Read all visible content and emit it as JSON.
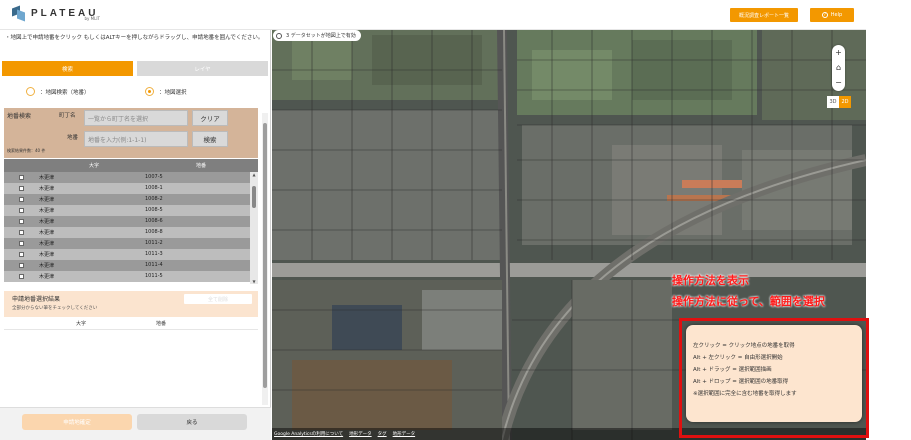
{
  "header": {
    "logo_text": "PLATEAU",
    "logo_sub": "by MLIT",
    "report_button": "概況調査レポート一覧",
    "help_button": "Help"
  },
  "left": {
    "instruction": "・地図上で申請地番をクリック もしくはALTキーを押しながらドラッグし、申請地番を囲んでください。",
    "tabs": [
      "検索",
      "レイヤ"
    ],
    "radio_options": [
      {
        "label": "：地図検索（地番）",
        "selected": false
      },
      {
        "label": "：地図選択",
        "selected": true
      }
    ],
    "search": {
      "title": "地番検索",
      "town_label": "町丁名",
      "town_placeholder": "一覧から町丁名を選択",
      "lot_label": "地番",
      "lot_placeholder": "地番を入力(例:1-1-1)",
      "clear_button": "クリア",
      "search_button": "検索",
      "result_count": "検索結果件数：40 件"
    },
    "table": {
      "headers": [
        "大字",
        "地番"
      ],
      "rows": [
        [
          "木更津",
          "1007-5"
        ],
        [
          "木更津",
          "1008-1"
        ],
        [
          "木更津",
          "1008-2"
        ],
        [
          "木更津",
          "1008-5"
        ],
        [
          "木更津",
          "1008-6"
        ],
        [
          "木更津",
          "1008-8"
        ],
        [
          "木更津",
          "1011-2"
        ],
        [
          "木更津",
          "1011-3"
        ],
        [
          "木更津",
          "1011-4"
        ],
        [
          "木更津",
          "1011-5"
        ]
      ]
    },
    "selected_result": {
      "title": "申請地番選択結果",
      "note": "全部分からない筆をチェックしてください",
      "clear_all_button": "全て削除",
      "headers": [
        "大字",
        "地番"
      ]
    },
    "footer": {
      "apply_button": "申請地確定",
      "back_button": "戻る"
    }
  },
  "map": {
    "dataset_status": "3 データセットが地図上で有効",
    "zoom_in": "+",
    "home": "⌂",
    "zoom_out": "−",
    "mode_3d": "3D",
    "mode_2d": "2D",
    "attribution": [
      "Google Analyticsの利用について",
      "地形データ",
      "タグ",
      "地形データ"
    ]
  },
  "annotation": {
    "line1": "操作方法を表示",
    "line2": "操作方法に従って、範囲を選択"
  },
  "help_popup": {
    "lines": [
      "左クリック = クリック地点の地番を取得",
      "Alt + 左クリック = 自由形選択開始",
      "Alt + ドラッグ = 選択範囲描画",
      "Alt + ドロップ = 選択範囲の地番取得",
      "※選択範囲に完全に含む地番を取得します"
    ]
  },
  "colors": {
    "accent": "#f39800",
    "annotation_red": "#ff1a1a",
    "search_panel": "#d4b499",
    "help_bg": "#fde5cf"
  }
}
